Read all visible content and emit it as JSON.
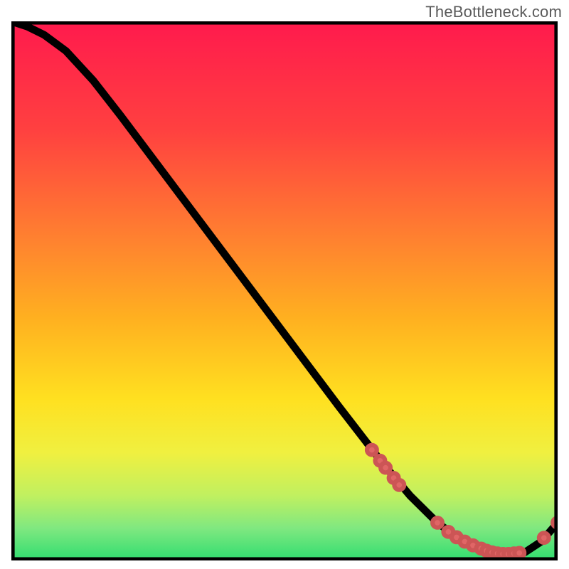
{
  "attribution": "TheBottleneck.com",
  "chart_data": {
    "type": "line",
    "title": "",
    "xlabel": "",
    "ylabel": "",
    "xlim": [
      0,
      100
    ],
    "ylim": [
      0,
      100
    ],
    "grid": false,
    "legend": false,
    "background_gradient": {
      "orientation": "vertical",
      "stops": [
        {
          "offset": 0.0,
          "color": "#ff1a4d"
        },
        {
          "offset": 0.2,
          "color": "#ff4040"
        },
        {
          "offset": 0.4,
          "color": "#ff8030"
        },
        {
          "offset": 0.55,
          "color": "#ffb020"
        },
        {
          "offset": 0.7,
          "color": "#ffe020"
        },
        {
          "offset": 0.8,
          "color": "#f0f040"
        },
        {
          "offset": 0.88,
          "color": "#c0f060"
        },
        {
          "offset": 0.94,
          "color": "#80e880"
        },
        {
          "offset": 1.0,
          "color": "#30dd70"
        }
      ]
    },
    "series": [
      {
        "name": "bottleneck-curve",
        "x": [
          0,
          3,
          6,
          10,
          15,
          20,
          30,
          40,
          50,
          60,
          68,
          73,
          78,
          82,
          86,
          90,
          94,
          97,
          100
        ],
        "y": [
          100,
          99,
          97.5,
          94.5,
          89,
          82.5,
          69,
          55.5,
          42,
          28.5,
          18,
          12,
          7,
          4,
          2.2,
          1.2,
          1.5,
          3.5,
          7
        ],
        "color": "#000000"
      }
    ],
    "markers": [
      {
        "name": "highlight-points",
        "color": "#e06666",
        "x": [
          66,
          67.5,
          68.5,
          70,
          71,
          78,
          80,
          81.5,
          83,
          84.5,
          86,
          87,
          88,
          89,
          90,
          91,
          92,
          93,
          97.5,
          100
        ],
        "y": [
          20.5,
          18.5,
          17.2,
          15.3,
          14,
          7,
          5.3,
          4.3,
          3.5,
          2.8,
          2.2,
          1.8,
          1.5,
          1.3,
          1.2,
          1.2,
          1.3,
          1.4,
          4.2,
          7
        ]
      }
    ]
  }
}
